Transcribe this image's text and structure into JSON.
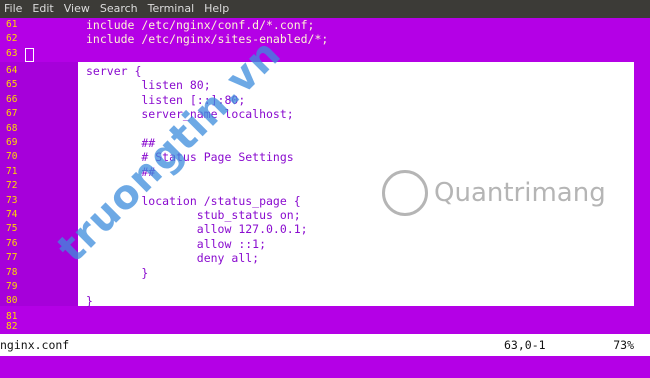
{
  "menubar": {
    "items": [
      "File",
      "Edit",
      "View",
      "Search",
      "Terminal",
      "Help"
    ]
  },
  "editor": {
    "lines": [
      {
        "num": "61",
        "text": "include /etc/nginx/conf.d/*.conf;"
      },
      {
        "num": "62",
        "text": "include /etc/nginx/sites-enabled/*;"
      },
      {
        "num": "63",
        "text": ""
      },
      {
        "num": "64",
        "text": "server {"
      },
      {
        "num": "65",
        "text": "        listen 80;"
      },
      {
        "num": "66",
        "text": "        listen [::]:80;"
      },
      {
        "num": "67",
        "text": "        server_name localhost;"
      },
      {
        "num": "68",
        "text": ""
      },
      {
        "num": "69",
        "text": "        ##"
      },
      {
        "num": "70",
        "text": "        # Status Page Settings"
      },
      {
        "num": "71",
        "text": "        ##"
      },
      {
        "num": "72",
        "text": ""
      },
      {
        "num": "73",
        "text": "        location /status_page {"
      },
      {
        "num": "74",
        "text": "                stub_status on;"
      },
      {
        "num": "75",
        "text": "                allow 127.0.0.1;"
      },
      {
        "num": "76",
        "text": "                allow ::1;"
      },
      {
        "num": "77",
        "text": "                deny all;"
      },
      {
        "num": "78",
        "text": "        }"
      },
      {
        "num": "79",
        "text": ""
      },
      {
        "num": "80",
        "text": "}"
      },
      {
        "num": "81",
        "text": ""
      },
      {
        "num": "82",
        "text": ""
      }
    ]
  },
  "statusbar": {
    "filename": "nginx.conf",
    "position": "63,0-1",
    "percent": "73%"
  },
  "watermarks": {
    "left": "truongtin.vn",
    "right": "Quantrimang"
  }
}
